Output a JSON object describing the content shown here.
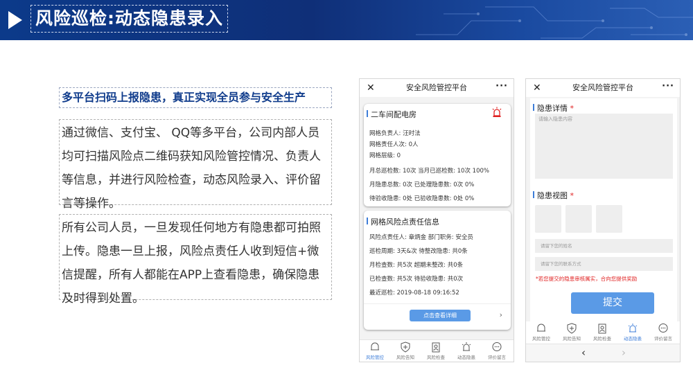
{
  "header": {
    "title": "风险巡检:动态隐患录入"
  },
  "subhead": "多平台扫码上报隐患，真正实现全员参与安全生产",
  "paragraphs": [
    "通过微信、支付宝、 QQ等多平台，公司内部人员均可扫描风险点二维码获知风险管控情况、负责人等信息，并进行风险检查，动态风险录入、评价留言等操作。",
    "所有公司人员，一旦发现任何地方有隐患都可拍照上传。隐患一旦上报，风险点责任人收到短信+微信提醒，所有人都能在APP上查看隐患，确保隐患及时得到处置。"
  ],
  "phone1": {
    "app_title": "安全风险管控平台",
    "close": "✕",
    "more": "···",
    "card1": {
      "title": "二车间配电房",
      "rows": [
        "网格负责人:      汪时法",
        "网格责任人次:    0人",
        "网格层级:     0",
        "月总巡检数:  10次     当月已巡检数:  10次      100%",
        "月隐患总数:  0次     已处理隐患数:  0次       0%",
        "待验收隐患:  0处     已验收隐患数:  0处       0%"
      ]
    },
    "card2": {
      "title": "网格风险点责任信息",
      "rows": [
        "风险点责任人:  章炳金       部门职务:  安全员",
        "巡检周期:  3天&次            待整改隐患:  共0条",
        "月检查数:  共5次              超期未整改:  共0条",
        "已检查数:  共5次              待验收隐患:  共0次",
        "最近巡检:    2019-08-18 09:16:52"
      ],
      "button": "点击查看详细",
      "chevron": "›"
    },
    "tabs": [
      {
        "label": "风险管控",
        "icon": "bell-icon",
        "active": true
      },
      {
        "label": "风险告知",
        "icon": "shield-icon",
        "active": false
      },
      {
        "label": "风险检查",
        "icon": "clipboard-user-icon",
        "active": false
      },
      {
        "label": "动态隐患",
        "icon": "alarm-icon",
        "active": false
      },
      {
        "label": "评价留言",
        "icon": "chat-icon",
        "active": false
      }
    ]
  },
  "phone2": {
    "app_title": "安全风险管控平台",
    "close": "✕",
    "more": "···",
    "detail_label": "隐患详情",
    "detail_placeholder": "请输入隐患内容",
    "view_label": "隐患视图",
    "required_mark": "*",
    "name_placeholder": "请留下您的姓名",
    "contact_placeholder": "请留下您的联系方式",
    "notice": "*若您提交的隐患审核属实，合向您提供奖励",
    "submit": "提交",
    "tabs": [
      {
        "label": "风险管控",
        "icon": "bell-icon",
        "active": false
      },
      {
        "label": "风险告知",
        "icon": "shield-icon",
        "active": false
      },
      {
        "label": "风险检查",
        "icon": "clipboard-user-icon",
        "active": false
      },
      {
        "label": "动态隐患",
        "icon": "alarm-icon",
        "active": true
      },
      {
        "label": "评价留言",
        "icon": "chat-icon",
        "active": false
      }
    ],
    "nav_back": "‹",
    "nav_forward": "›"
  },
  "colors": {
    "banner": "#0f2f78",
    "accent": "#3d7dd8",
    "button": "#5a9ae6",
    "warning": "#e02020",
    "subhead": "#103c8c"
  }
}
